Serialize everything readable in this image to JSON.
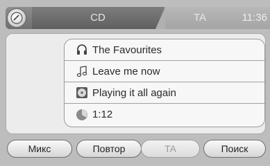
{
  "header": {
    "disc_icon": "cd-disc-icon",
    "tab_active": "CD",
    "tab_inactive": "TA",
    "clock": "11:36"
  },
  "track_info": [
    {
      "icon": "headphones-icon",
      "text": "The Favourites"
    },
    {
      "icon": "music-note-icon",
      "text": "Leave me now"
    },
    {
      "icon": "cd-album-icon",
      "text": "Playing it all again"
    },
    {
      "icon": "time-pie-icon",
      "text": "1:12"
    }
  ],
  "buttons": {
    "mix": "Микс",
    "repeat": "Повтор",
    "ta": "TA",
    "search": "Поиск"
  }
}
